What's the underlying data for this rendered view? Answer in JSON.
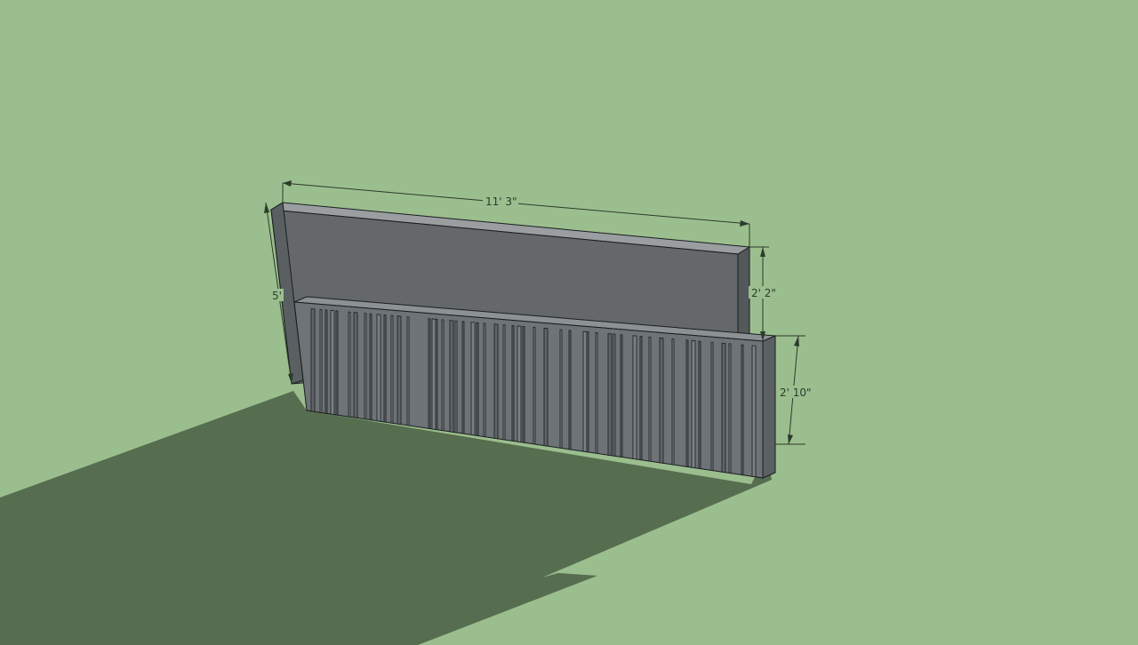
{
  "viewport": {
    "background_color": "#9bbe8e",
    "ground_shadow_color": "#566e4f",
    "wall_face_color": "#646869",
    "wall_top_color": "#909597",
    "wall_side_color": "#53585a",
    "base_face_color": "#6e7377",
    "edge_color": "#1a1d1f",
    "dimension_color": "#2b3b2b"
  },
  "dimensions": {
    "length": "11' 3\"",
    "wall_height": "5'",
    "upper_offset": "2' 2\"",
    "base_height": "2' 10\""
  }
}
